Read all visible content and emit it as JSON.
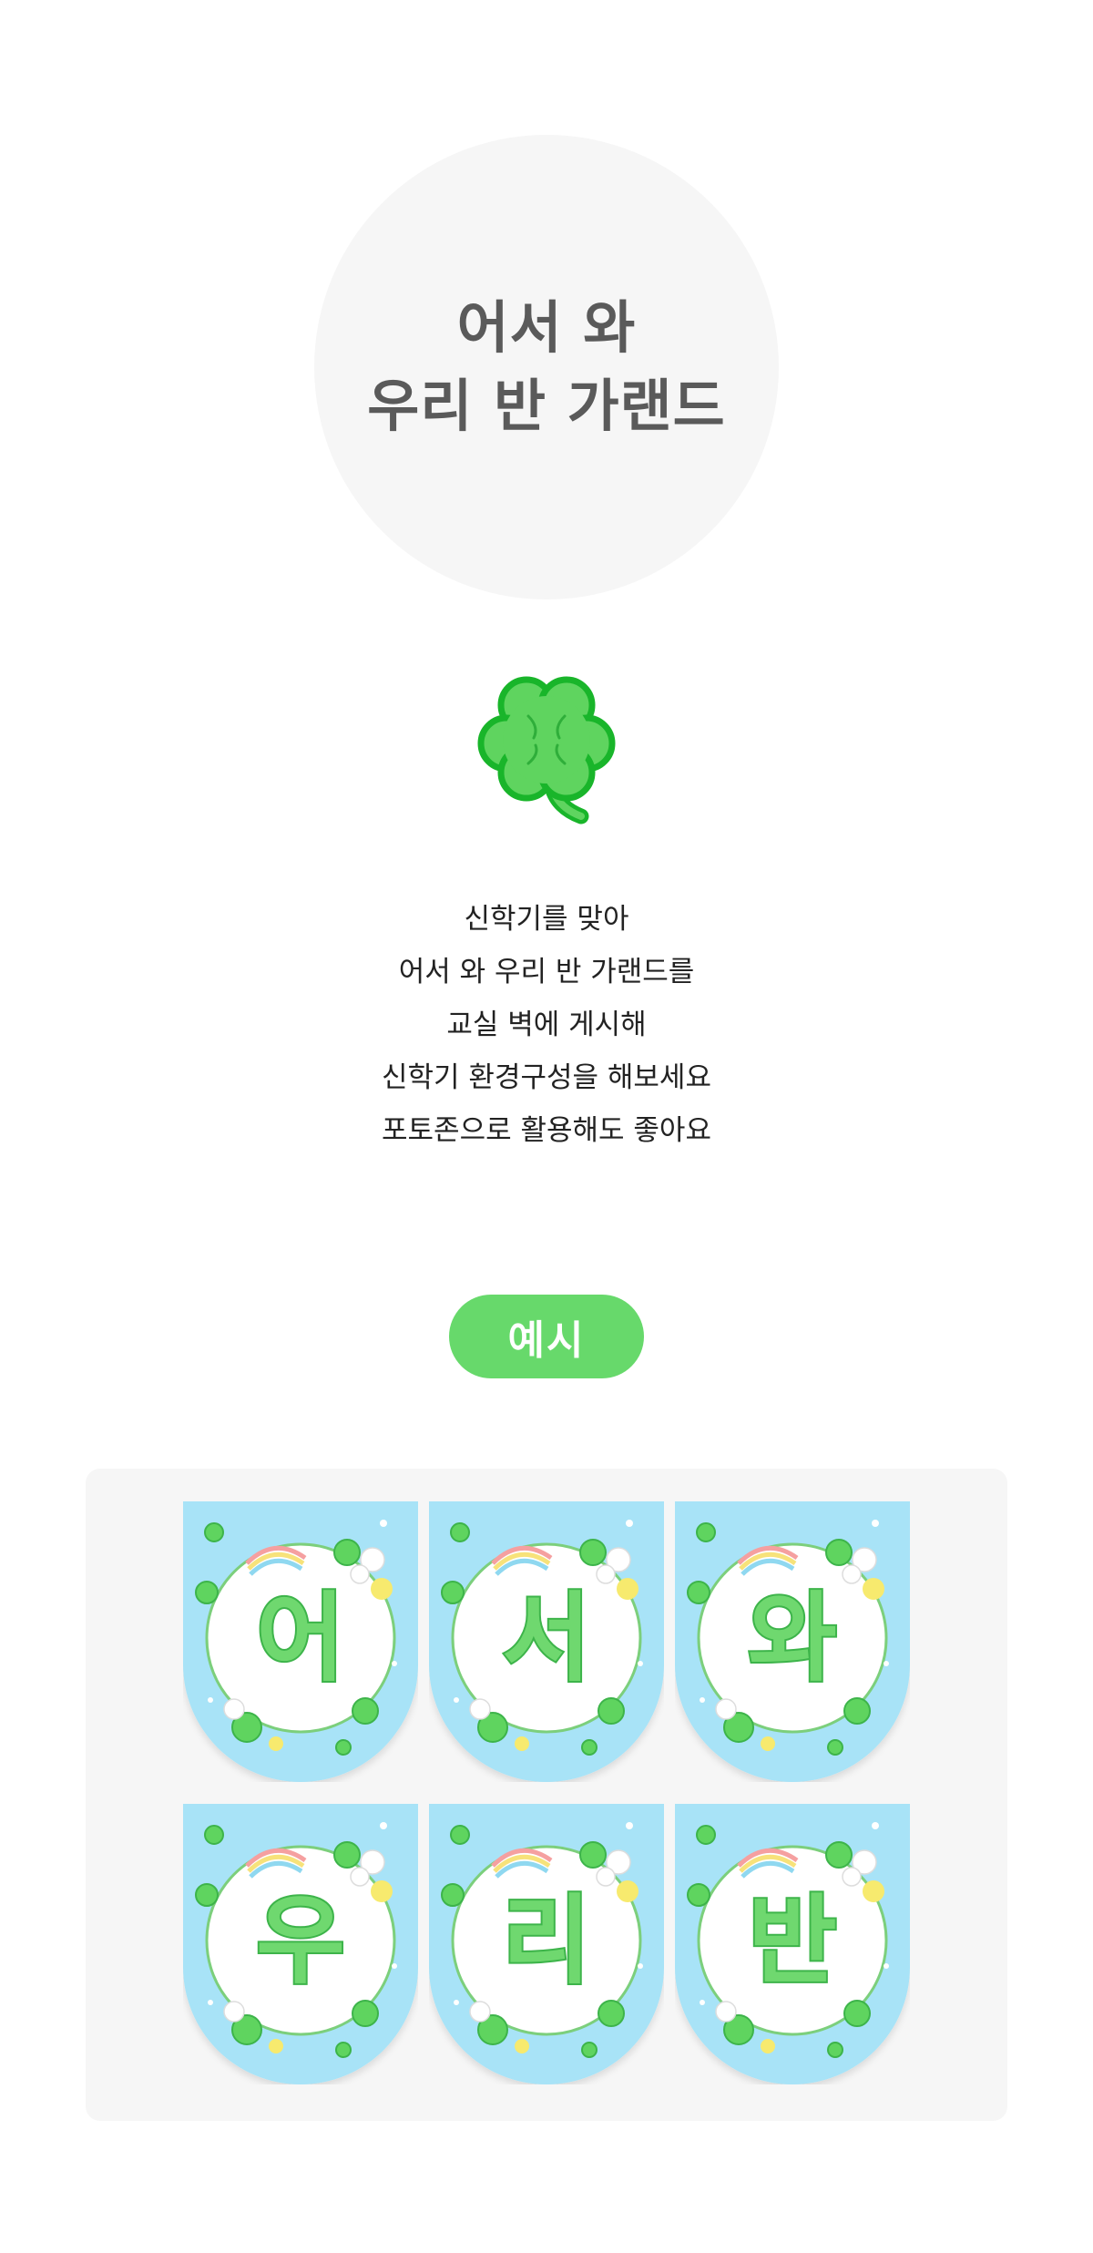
{
  "hero": {
    "title_lines": [
      "어서 와",
      "우리 반 가랜드"
    ]
  },
  "description": {
    "lines": [
      "신학기를 맞아",
      "어서 와 우리 반 가랜드를",
      "교실 벽에 게시해",
      "신학기 환경구성을 해보세요",
      "포토존으로 활용해도 좋아요"
    ]
  },
  "example": {
    "label": "예시"
  },
  "pennants": [
    "어",
    "서",
    "와",
    "우",
    "리",
    "반"
  ],
  "colors": {
    "hero_bg": "#f6f6f6",
    "accent_green": "#67d96b",
    "pennant_blue": "#a8e3f7",
    "clover_green": "#5fd45f"
  }
}
